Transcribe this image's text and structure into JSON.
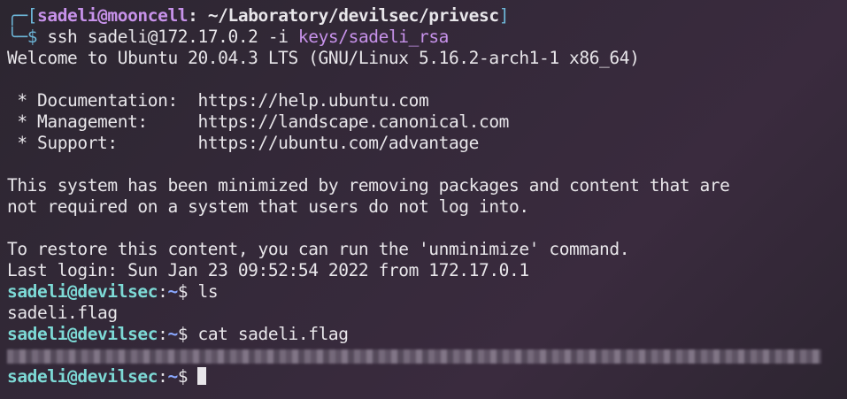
{
  "local_prompt": {
    "frame_top": "╭─[",
    "user_host": "sadeli@mooncell",
    "sep": ": ",
    "path": "~/Laboratory/devilsec/privesc",
    "close": "]",
    "frame_bottom": "╰─",
    "dollar": "$ "
  },
  "ssh_command": {
    "name": "ssh",
    "target": " sadeli@172.17.0.2",
    "flag": " -i ",
    "key": "keys/sadeli_rsa"
  },
  "motd": {
    "welcome": "Welcome to Ubuntu 20.04.3 LTS (GNU/Linux 5.16.2-arch1-1 x86_64)",
    "doc": " * Documentation:  https://help.ubuntu.com",
    "mgmt": " * Management:     https://landscape.canonical.com",
    "support": " * Support:        https://ubuntu.com/advantage",
    "minimized1": "This system has been minimized by removing packages and content that are",
    "minimized2": "not required on a system that users do not log into.",
    "restore": "To restore this content, you can run the 'unminimize' command.",
    "last_login": "Last login: Sun Jan 23 09:52:54 2022 from 172.17.0.1"
  },
  "remote_prompt": {
    "user_host": "sadeli@devilsec",
    "colon": ":",
    "tilde": "~",
    "dollar": "$ "
  },
  "commands": {
    "ls": "ls",
    "ls_output": "sadeli.flag",
    "cat": "cat sadeli.flag"
  },
  "colors": {
    "background": "#35293a",
    "accent_cyan": "#6db6d8",
    "accent_purple": "#c792ea",
    "remote_user": "#7ddad6",
    "tilde_blue": "#8aa8ff"
  }
}
